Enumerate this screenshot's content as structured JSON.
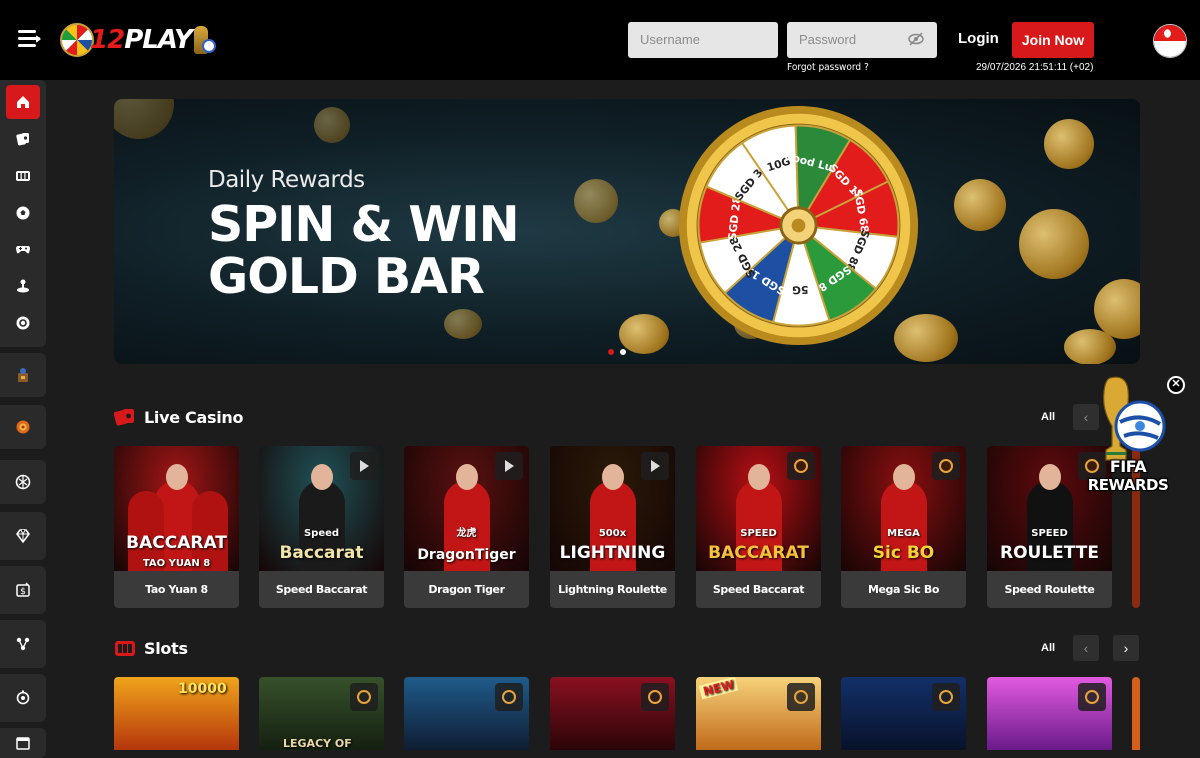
{
  "header": {
    "logo_text_num": "12",
    "logo_text_word": "PLAY",
    "username_placeholder": "Username",
    "password_placeholder": "Password",
    "forgot_password": "Forgot password ?",
    "login_label": "Login",
    "join_label": "Join Now",
    "datetime": "29/07/2026 21:51:11 (+02)",
    "language_flag": "singapore-flag-icon"
  },
  "sidebar": {
    "items": [
      {
        "icon": "home-icon",
        "active": true
      },
      {
        "icon": "live-casino-icon"
      },
      {
        "icon": "slots-icon"
      },
      {
        "icon": "sports-icon"
      },
      {
        "icon": "esports-icon"
      },
      {
        "icon": "fishing-icon"
      },
      {
        "icon": "lottery-icon"
      },
      {
        "icon": "promotion-icon"
      },
      {
        "icon": "rewards-icon"
      },
      {
        "icon": "vip-icon"
      },
      {
        "icon": "diamond-icon"
      },
      {
        "icon": "deposit-icon"
      },
      {
        "icon": "referral-icon"
      },
      {
        "icon": "support-icon"
      },
      {
        "icon": "calendar-icon"
      }
    ]
  },
  "banner": {
    "subtitle": "Daily Rewards",
    "title_line1": "SPIN & WIN",
    "title_line2": "GOLD BAR",
    "wheel_segments": [
      "10G",
      "Good Luck",
      "SGD 18",
      "SGD 688",
      "SGD 88",
      "SGD 8",
      "5G",
      "SGD 12",
      "SGD 288",
      "SGD 28",
      "SGD 3"
    ],
    "slide_count": 2,
    "active_slide": 1
  },
  "live_casino": {
    "title": "Live Casino",
    "all_label": "All",
    "prev_arrow": "‹",
    "games": [
      {
        "name": "Tao Yuan 8",
        "caption": "BACCARAT",
        "caption2": "TAO YUAN 8",
        "bg": "#a31616"
      },
      {
        "name": "Speed Baccarat",
        "caption": "Baccarat",
        "caption2": "Speed",
        "bg": "#1f5257"
      },
      {
        "name": "Dragon Tiger",
        "caption": "DragonTiger",
        "caption2": "龙虎",
        "bg": "#5a1010"
      },
      {
        "name": "Lightning Roulette",
        "caption": "LIGHTNING",
        "caption2": "500x",
        "bg": "#2a1a08"
      },
      {
        "name": "Speed Baccarat",
        "caption": "BACCARAT",
        "caption2": "SPEED",
        "bg": "#b80f14"
      },
      {
        "name": "Mega Sic Bo",
        "caption": "Sic BO",
        "caption2": "MEGA",
        "bg": "#8a0f10"
      },
      {
        "name": "Speed Roulette",
        "caption": "ROULETTE",
        "caption2": "SPEED",
        "bg": "#5e0a0d"
      }
    ]
  },
  "slots": {
    "title": "Slots",
    "all_label": "All",
    "prev_arrow": "‹",
    "next_arrow": "›",
    "games": [
      {
        "name": "slot-fortune",
        "text": "10000",
        "bg1": "#f0a41a",
        "bg2": "#b5360c"
      },
      {
        "name": "slot-legacy-of-kong",
        "text": "LEGACY OF",
        "bg1": "#37512a",
        "bg2": "#142010"
      },
      {
        "name": "slot-panther",
        "text": "",
        "bg1": "#1f5b8a",
        "bg2": "#0e1d33"
      },
      {
        "name": "slot-sevens",
        "text": "",
        "bg1": "#8a1020",
        "bg2": "#2a0508"
      },
      {
        "name": "slot-gates-of-olympus",
        "text": "NEW",
        "bg1": "#f7d27a",
        "bg2": "#c06a1a"
      },
      {
        "name": "slot-zeus",
        "text": "",
        "bg1": "#12306a",
        "bg2": "#08122a"
      },
      {
        "name": "slot-sweet-bonanza",
        "text": "",
        "bg1": "#e25ae0",
        "bg2": "#6a1a8a"
      }
    ]
  },
  "fifa_promo": {
    "line1": "FIFA",
    "line2": "REWARDS",
    "close": "✕"
  }
}
